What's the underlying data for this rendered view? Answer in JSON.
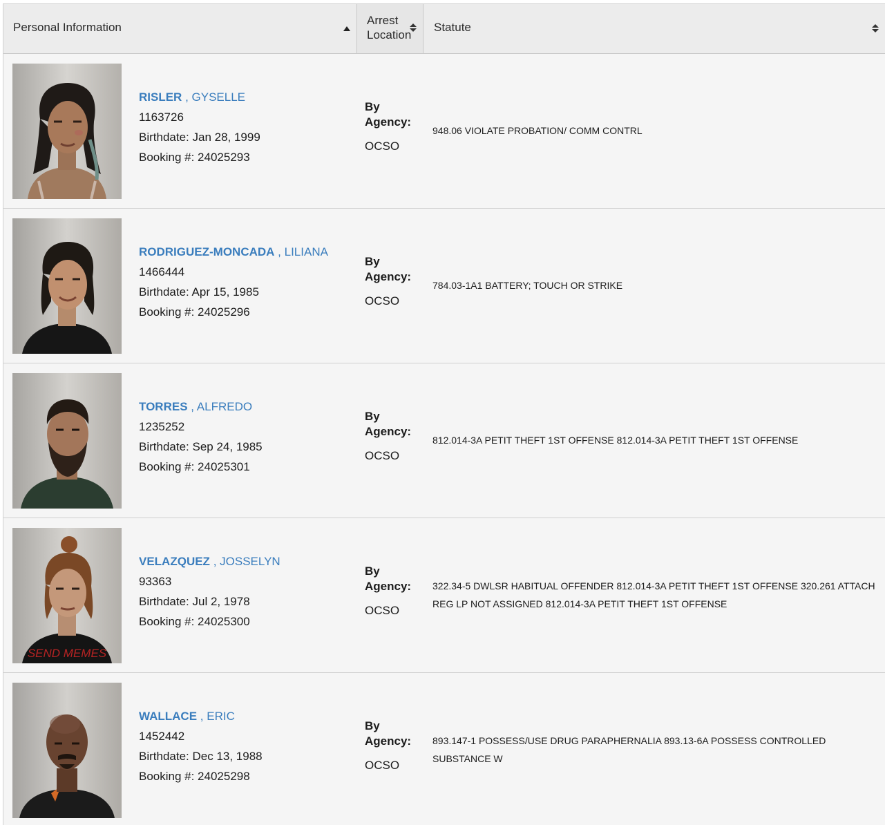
{
  "header": {
    "personal_label": "Personal Information",
    "arrest_label": "Arrest Location",
    "statute_label": "Statute"
  },
  "inmates": [
    {
      "last": "RISLER",
      "first": ", GYSELLE",
      "id": "1163726",
      "birthdate": "Birthdate: Jan 28, 1999",
      "booking": "Booking #: 24025293",
      "by_agency": "By Agency:",
      "agency": "OCSO",
      "statute": "948.06 VIOLATE PROBATION/ COMM CONTRL"
    },
    {
      "last": "RODRIGUEZ-MONCADA",
      "first": ", LILIANA",
      "id": "1466444",
      "birthdate": "Birthdate: Apr 15, 1985",
      "booking": "Booking #: 24025296",
      "by_agency": "By Agency:",
      "agency": "OCSO",
      "statute": "784.03-1A1 BATTERY; TOUCH OR STRIKE"
    },
    {
      "last": "TORRES",
      "first": ", ALFREDO",
      "id": "1235252",
      "birthdate": "Birthdate: Sep 24, 1985",
      "booking": "Booking #: 24025301",
      "by_agency": "By Agency:",
      "agency": "OCSO",
      "statute": "812.014-3A PETIT THEFT 1ST OFFENSE 812.014-3A PETIT THEFT 1ST OFFENSE"
    },
    {
      "last": "VELAZQUEZ",
      "first": ", JOSSELYN",
      "id": "93363",
      "birthdate": "Birthdate: Jul 2, 1978",
      "booking": "Booking #: 24025300",
      "by_agency": "By Agency:",
      "agency": "OCSO",
      "statute": "322.34-5 DWLSR HABITUAL OFFENDER 812.014-3A PETIT THEFT 1ST OFFENSE 320.261 ATTACH REG LP NOT ASSIGNED 812.014-3A PETIT THEFT 1ST OFFENSE",
      "shirt_text": "SEND MEMES"
    },
    {
      "last": "WALLACE",
      "first": ", ERIC",
      "id": "1452442",
      "birthdate": "Birthdate: Dec 13, 1988",
      "booking": "Booking #: 24025298",
      "by_agency": "By Agency:",
      "agency": "OCSO",
      "statute": "893.147-1 POSSESS/USE DRUG PARAPHERNALIA 893.13-6A POSSESS CONTROLLED SUBSTANCE W"
    }
  ],
  "colors": {
    "link": "#3a7dbd",
    "row_bg": "#f5f5f5",
    "header_bg": "#ececec"
  }
}
